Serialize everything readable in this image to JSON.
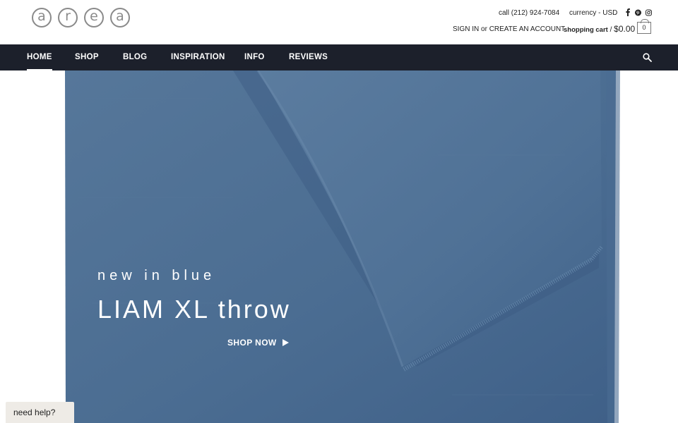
{
  "brand": {
    "logo_letters": [
      "a",
      "r",
      "e",
      "a"
    ]
  },
  "header": {
    "phone": "call (212) 924-7084",
    "currency": "currency - USD",
    "social_icons": [
      "facebook-icon",
      "pinterest-icon",
      "instagram-icon"
    ],
    "sign_in": "SIGN IN",
    "or": " or ",
    "create_account": "CREATE AN ACCOUNT",
    "cart_label": "shopping cart",
    "cart_separator": " / ",
    "cart_total": "$0.00",
    "cart_count": "0"
  },
  "nav": {
    "items": [
      "HOME",
      "SHOP",
      "BLOG",
      "INSPIRATION",
      "INFO",
      "REVIEWS"
    ],
    "active": "HOME",
    "search_icon": "search-icon"
  },
  "hero": {
    "eyebrow": "new in blue",
    "title": "LIAM XL throw",
    "cta": "SHOP NOW",
    "cta_icon": "play-arrow-icon"
  },
  "help": {
    "label": "need help?"
  },
  "colors": {
    "nav_bg": "#1c202b",
    "throw_blue": "#4d6f93",
    "text_light": "#ffffff",
    "help_bg": "#eeebe6"
  }
}
